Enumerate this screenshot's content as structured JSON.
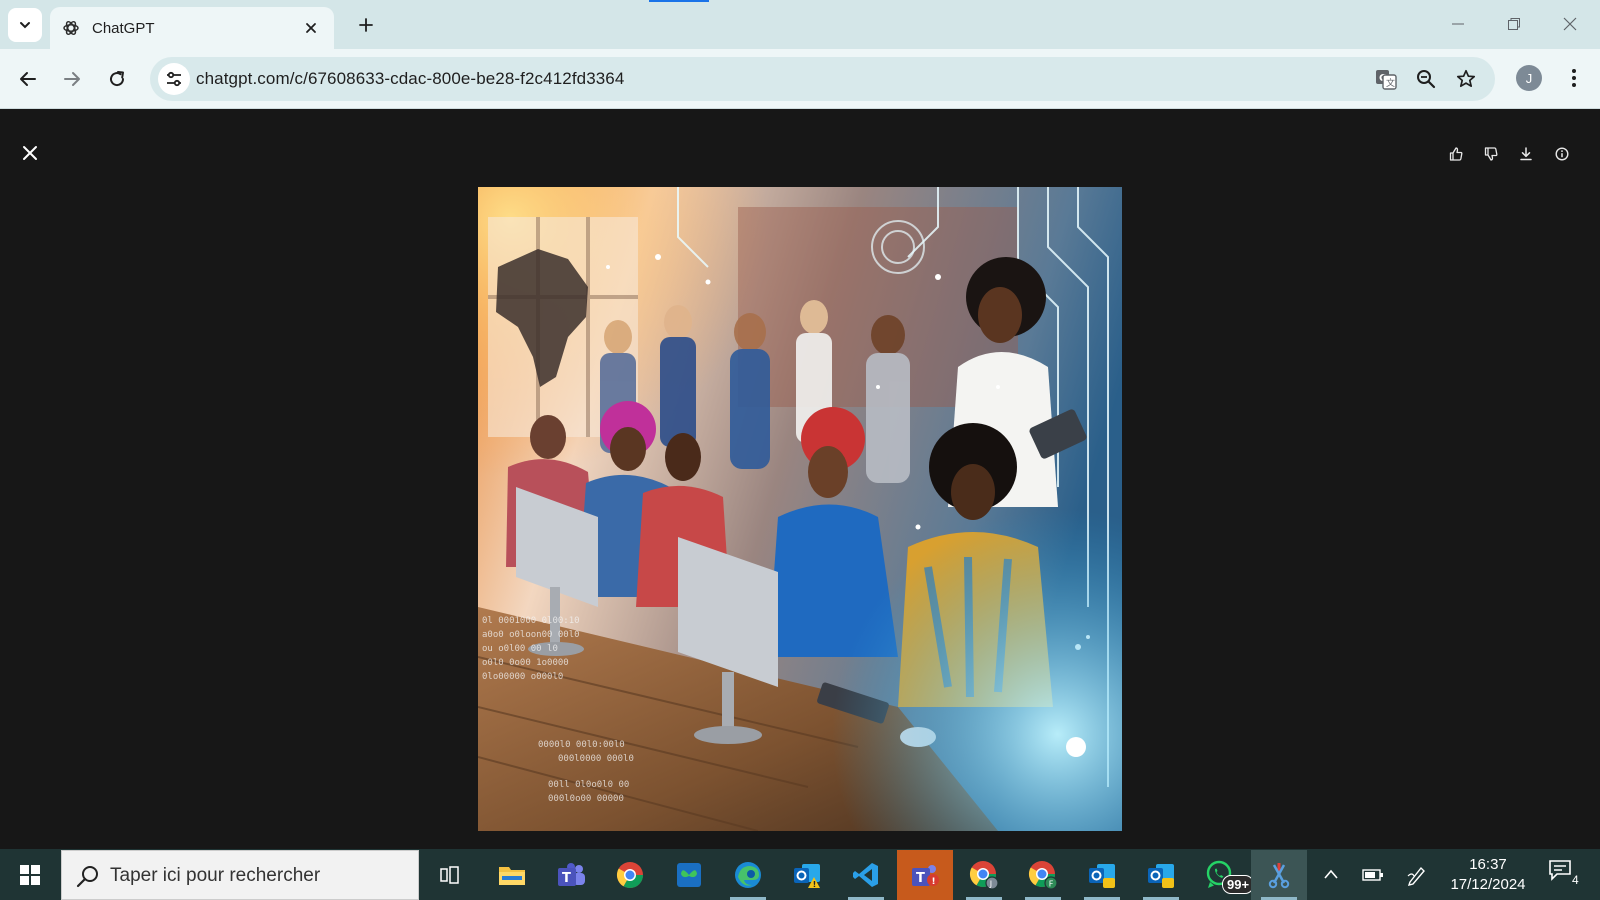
{
  "browser": {
    "tab": {
      "title": "ChatGPT",
      "favicon": "openai-logo-icon"
    },
    "address": {
      "url": "chatgpt.com/c/67608633-cdac-800e-be28-f2c412fd3364"
    },
    "profile_initial": "J",
    "icons": {
      "tab_list": "chevron-down-icon",
      "close_tab": "close-icon",
      "new_tab": "plus-icon",
      "back": "arrow-left-icon",
      "forward": "arrow-right-icon",
      "reload": "reload-icon",
      "site_info": "tune-icon",
      "translate": "translate-icon",
      "zoom": "zoom-out-icon",
      "bookmark": "star-icon",
      "menu": "three-dots-icon"
    }
  },
  "viewer": {
    "image_kind": "generated illustration of women working at computers with an Africa map and digital circuit motifs",
    "actions": [
      "thumbs-up-icon",
      "thumbs-down-icon",
      "download-icon",
      "info-icon"
    ],
    "colors": {
      "background": "#171717"
    }
  },
  "taskbar": {
    "search_placeholder": "Taper ici pour rechercher",
    "apps": [
      "task-view",
      "file-explorer",
      "teams",
      "chrome",
      "store-app",
      "edge",
      "outlook",
      "vscode",
      "teams-alert",
      "chrome-profile-j",
      "chrome-profile-f",
      "outlook-2",
      "outlook-3",
      "whatsapp",
      "snipping-tool"
    ],
    "whatsapp_badge": "99+",
    "clock": {
      "time": "16:37",
      "date": "17/12/2024"
    },
    "notification_count": "4",
    "colors": {
      "taskbar": "#1f3434",
      "highlight": "#c75a1c"
    }
  }
}
